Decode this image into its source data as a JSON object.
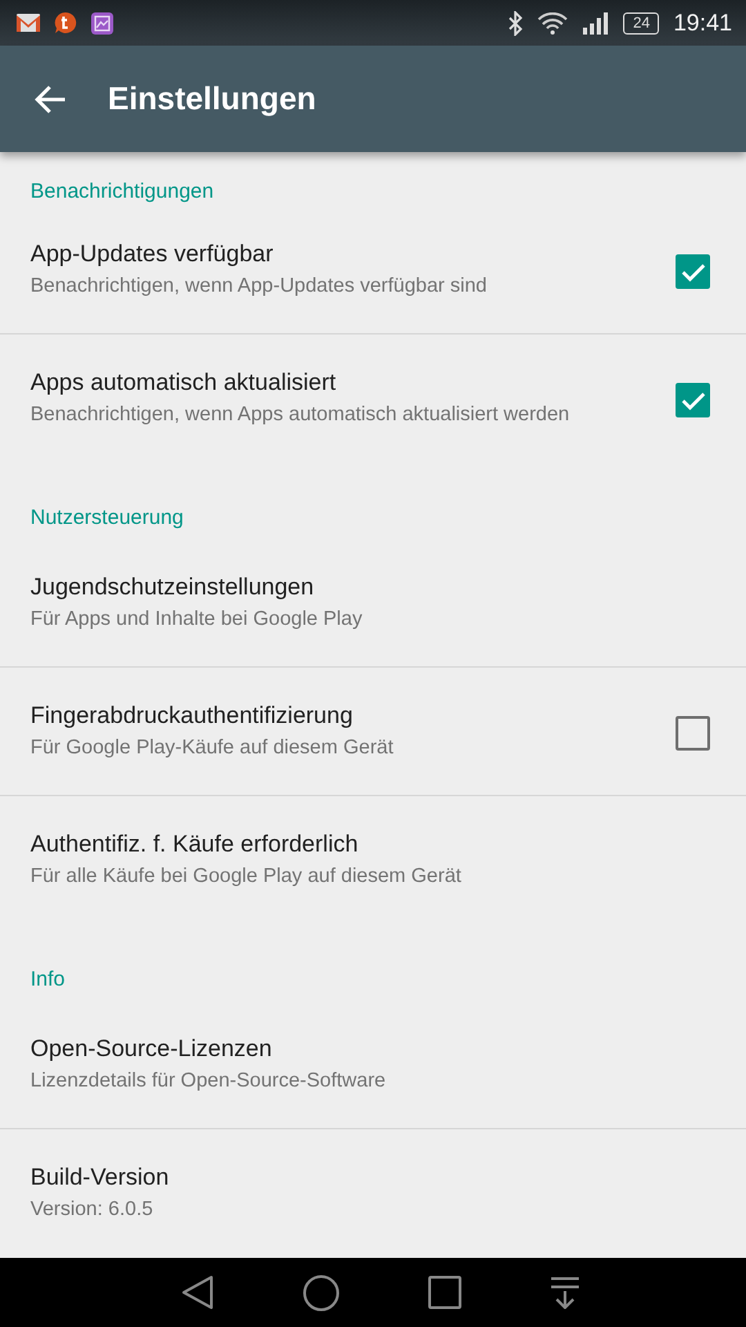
{
  "status_bar": {
    "time": "19:41",
    "battery": "24"
  },
  "toolbar": {
    "title": "Einstellungen"
  },
  "sections": [
    {
      "title": "Benachrichtigungen",
      "items": [
        {
          "kind": "checkbox",
          "title": "App-Updates verfügbar",
          "summary": "Benachrichtigen, wenn App-Updates verfügbar sind",
          "checked": true
        },
        {
          "kind": "checkbox",
          "title": "Apps automatisch aktualisiert",
          "summary": "Benachrichtigen, wenn Apps automatisch aktualisiert werden",
          "checked": true
        }
      ]
    },
    {
      "title": "Nutzersteuerung",
      "items": [
        {
          "kind": "plain",
          "title": "Jugendschutzeinstellungen",
          "summary": "Für Apps und Inhalte bei Google Play"
        },
        {
          "kind": "checkbox",
          "title": "Fingerabdruckauthentifizierung",
          "summary": "Für Google Play-Käufe auf diesem Gerät",
          "checked": false
        },
        {
          "kind": "plain",
          "title": "Authentifiz. f. Käufe erforderlich",
          "summary": "Für alle Käufe bei Google Play auf diesem Gerät"
        }
      ]
    },
    {
      "title": "Info",
      "items": [
        {
          "kind": "plain",
          "title": "Open-Source-Lizenzen",
          "summary": "Lizenzdetails für Open-Source-Software"
        },
        {
          "kind": "plain",
          "title": "Build-Version",
          "summary": "Version: 6.0.5"
        }
      ]
    }
  ]
}
